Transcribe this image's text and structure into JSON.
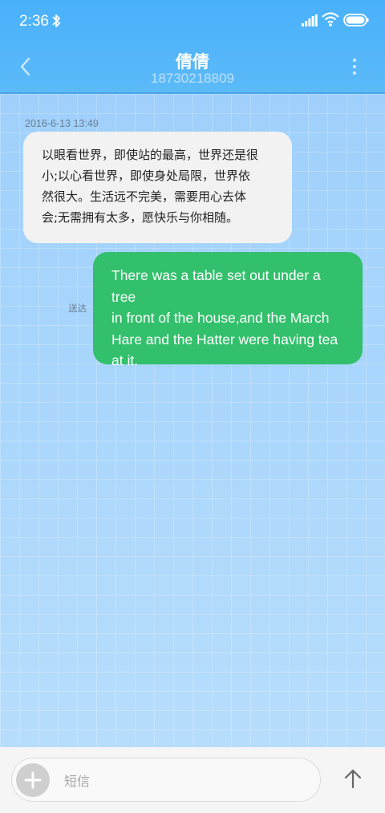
{
  "status_bar": {
    "time": "2:36"
  },
  "header": {
    "contact_name": "倩倩",
    "contact_number": "18730218809"
  },
  "conversation": {
    "timestamp": "2016-6-13 13:49",
    "incoming": {
      "lines": [
        "以眼看世界，即使站的最高，世界还是很",
        "小;以心看世界，即使身处局限，世界依",
        "然很大。生活远不完美，需要用心去体",
        "会;无需拥有太多，愿快乐与你相随。"
      ]
    },
    "outgoing": {
      "lines": [
        "There was a table set out under a tree",
        "in front of the house,and the March",
        "Hare and the Hatter were having tea",
        "at it."
      ],
      "status": "送达"
    }
  },
  "composer": {
    "placeholder": "短信"
  },
  "colors": {
    "header": "#49b1fb",
    "chat_background": "#a8d5fb",
    "incoming_bubble": "#f2f2f2",
    "outgoing_bubble": "#33c06c"
  },
  "icons": [
    "bluetooth-icon",
    "signal-icon",
    "wifi-icon",
    "battery-icon",
    "back-icon",
    "more-icon",
    "plus-icon",
    "send-arrow-icon"
  ]
}
